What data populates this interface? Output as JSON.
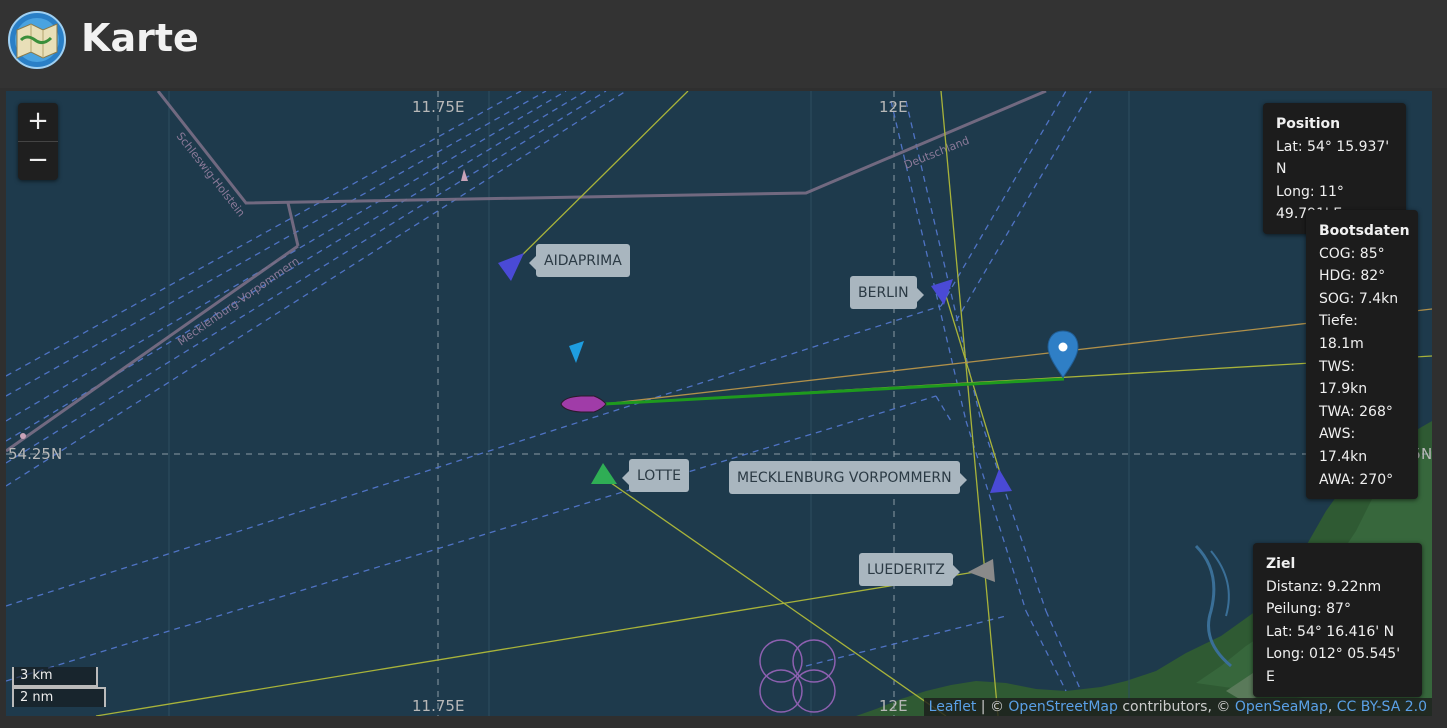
{
  "header": {
    "title": "Karte",
    "logo_icon": "map-icon"
  },
  "map": {
    "zoom_in_label": "+",
    "zoom_out_label": "−",
    "grid_labels": {
      "lon1_top": "11.75E",
      "lon2_top": "12E",
      "lon1_bottom": "11.75E",
      "lon2_bottom": "12E",
      "lat_left": "54.25N",
      "lat_right": "54.25N"
    },
    "ships": [
      {
        "name": "AIDAPRIMA",
        "color": "#4a4ad6"
      },
      {
        "name": "BERLIN",
        "color": "#4a4ad6"
      },
      {
        "name": "LOTTE",
        "color": "#2fae55"
      },
      {
        "name": "MECKLENBURG VORPOMMERN",
        "color": "#4a4ad6"
      },
      {
        "name": "LUEDERITZ",
        "color": "#8a8a8a"
      }
    ],
    "own_boat_color": "#a03ca8",
    "target_marker": "map-pin-icon",
    "scale": {
      "km": "3 km",
      "nm": "2 nm"
    },
    "attribution": {
      "leaflet": "Leaflet",
      "sep1": " | © ",
      "osm": "OpenStreetMap",
      "contributors": " contributors, © ",
      "openseamap": "OpenSeaMap",
      "comma": ", ",
      "license": "CC BY-SA 2.0"
    }
  },
  "position": {
    "title": "Position",
    "lat": "Lat: 54° 15.937' N",
    "long": "Long: 11° 49.791' E"
  },
  "bootsdaten": {
    "title": "Bootsdaten",
    "cog": "COG: 85°",
    "hdg": "HDG: 82°",
    "sog": "SOG: 7.4kn",
    "tiefe": "Tiefe: 18.1m",
    "tws": "TWS: 17.9kn",
    "twa": "TWA: 268°",
    "aws": "AWS: 17.4kn",
    "awa": "AWA: 270°"
  },
  "ziel": {
    "title": "Ziel",
    "distanz": "Distanz: 9.22nm",
    "peilung": "Peilung: 87°",
    "lat": "Lat: 54° 16.416' N",
    "long": "Long: 012° 05.545' E"
  }
}
